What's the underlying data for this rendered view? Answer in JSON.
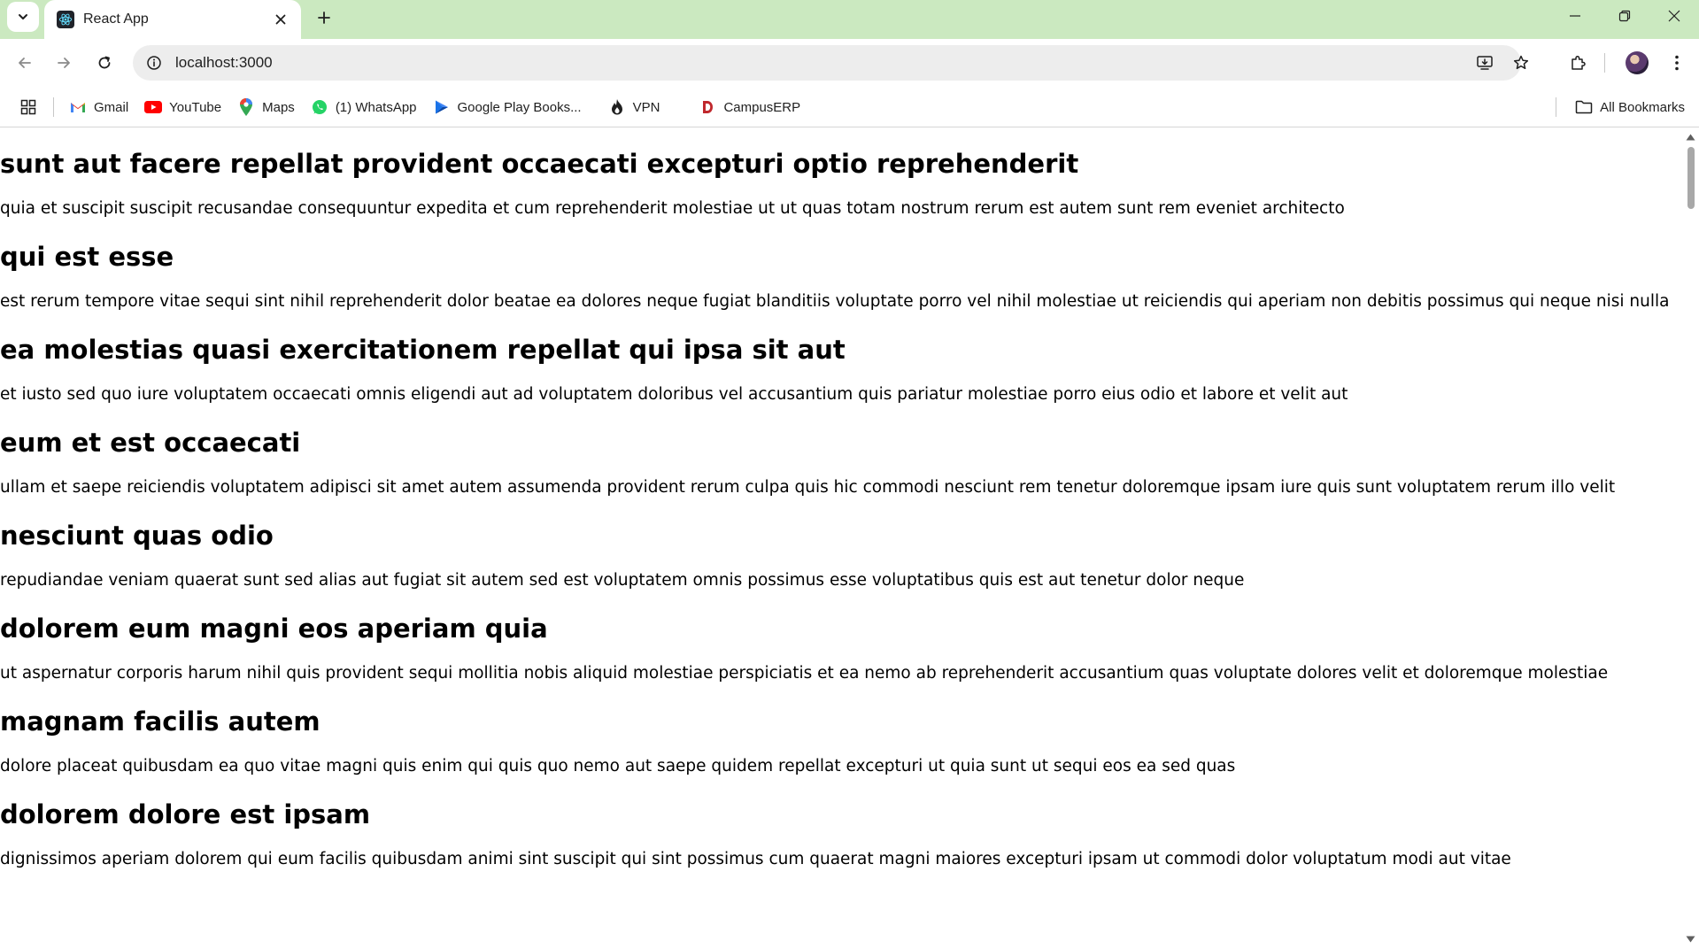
{
  "browser": {
    "tab": {
      "title": "React App"
    },
    "address": {
      "url": "localhost:3000"
    },
    "bookmarks": [
      {
        "label": "Gmail",
        "icon": "gmail-icon"
      },
      {
        "label": "YouTube",
        "icon": "youtube-icon"
      },
      {
        "label": "Maps",
        "icon": "maps-icon"
      },
      {
        "label": "(1) WhatsApp",
        "icon": "whatsapp-icon"
      },
      {
        "label": "Google Play Books...",
        "icon": "play-books-icon"
      },
      {
        "label": "VPN",
        "icon": "vpn-icon"
      },
      {
        "label": "CampusERP",
        "icon": "campuserp-icon"
      }
    ],
    "all_bookmarks_label": "All Bookmarks"
  },
  "posts": [
    {
      "title": "sunt aut facere repellat provident occaecati excepturi optio reprehenderit",
      "body": "quia et suscipit suscipit recusandae consequuntur expedita et cum reprehenderit molestiae ut ut quas totam nostrum rerum est autem sunt rem eveniet architecto"
    },
    {
      "title": "qui est esse",
      "body": "est rerum tempore vitae sequi sint nihil reprehenderit dolor beatae ea dolores neque fugiat blanditiis voluptate porro vel nihil molestiae ut reiciendis qui aperiam non debitis possimus qui neque nisi nulla"
    },
    {
      "title": "ea molestias quasi exercitationem repellat qui ipsa sit aut",
      "body": "et iusto sed quo iure voluptatem occaecati omnis eligendi aut ad voluptatem doloribus vel accusantium quis pariatur molestiae porro eius odio et labore et velit aut"
    },
    {
      "title": "eum et est occaecati",
      "body": "ullam et saepe reiciendis voluptatem adipisci sit amet autem assumenda provident rerum culpa quis hic commodi nesciunt rem tenetur doloremque ipsam iure quis sunt voluptatem rerum illo velit"
    },
    {
      "title": "nesciunt quas odio",
      "body": "repudiandae veniam quaerat sunt sed alias aut fugiat sit autem sed est voluptatem omnis possimus esse voluptatibus quis est aut tenetur dolor neque"
    },
    {
      "title": "dolorem eum magni eos aperiam quia",
      "body": "ut aspernatur corporis harum nihil quis provident sequi mollitia nobis aliquid molestiae perspiciatis et ea nemo ab reprehenderit accusantium quas voluptate dolores velit et doloremque molestiae"
    },
    {
      "title": "magnam facilis autem",
      "body": "dolore placeat quibusdam ea quo vitae magni quis enim qui quis quo nemo aut saepe quidem repellat excepturi ut quia sunt ut sequi eos ea sed quas"
    },
    {
      "title": "dolorem dolore est ipsam",
      "body": "dignissimos aperiam dolorem qui eum facilis quibusdam animi sint suscipit qui sint possimus cum quaerat magni maiores excepturi ipsam ut commodi dolor voluptatum modi aut vitae"
    }
  ]
}
